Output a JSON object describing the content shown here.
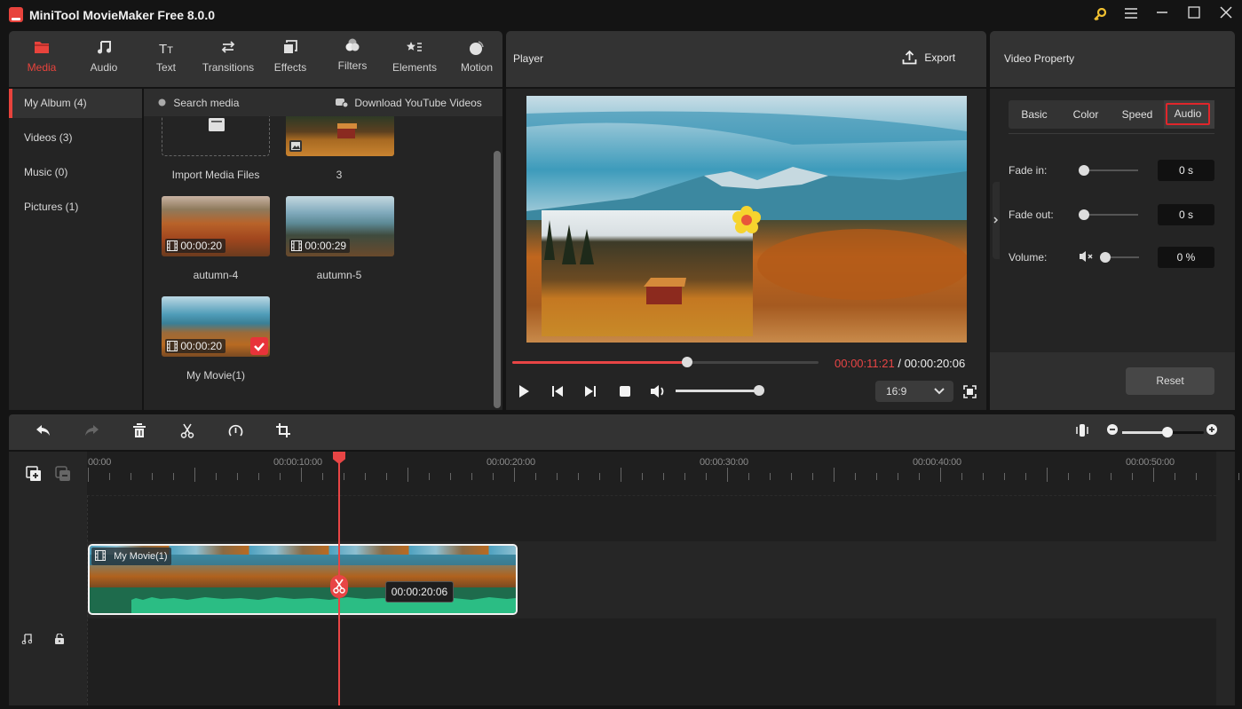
{
  "app": {
    "title": "MiniTool MovieMaker Free 8.0.0",
    "window_buttons": [
      "key-icon",
      "menu-icon",
      "minimize-icon",
      "maximize-icon",
      "close-icon"
    ]
  },
  "toolbar": {
    "items": [
      {
        "label": "Media",
        "icon": "folder-icon",
        "active": true
      },
      {
        "label": "Audio",
        "icon": "music-icon"
      },
      {
        "label": "Text",
        "icon": "text-icon"
      },
      {
        "label": "Transitions",
        "icon": "transitions-icon"
      },
      {
        "label": "Effects",
        "icon": "effects-icon"
      },
      {
        "label": "Filters",
        "icon": "filters-icon"
      },
      {
        "label": "Elements",
        "icon": "elements-icon"
      },
      {
        "label": "Motion",
        "icon": "motion-icon"
      }
    ]
  },
  "sidebar": {
    "categories": [
      {
        "label": "My Album (4)",
        "active": true
      },
      {
        "label": "Videos (3)"
      },
      {
        "label": "Music (0)"
      },
      {
        "label": "Pictures (1)"
      }
    ]
  },
  "media": {
    "search_placeholder": "Search media",
    "download_label": "Download YouTube Videos",
    "items": [
      {
        "name": "Import Media Files",
        "type": "import"
      },
      {
        "name": "3",
        "type": "image"
      },
      {
        "name": "autumn-4",
        "type": "video",
        "duration": "00:00:20"
      },
      {
        "name": "autumn-5",
        "type": "video",
        "duration": "00:00:29"
      },
      {
        "name": "My Movie(1)",
        "type": "video",
        "duration": "00:00:20",
        "added": true
      }
    ]
  },
  "player": {
    "title": "Player",
    "export_label": "Export",
    "current_time": "00:00:11:21",
    "total_time": "/ 00:00:20:06",
    "progress_fraction": 0.57,
    "volume_fraction": 1.0,
    "aspect_ratio": "16:9"
  },
  "property": {
    "title": "Video Property",
    "tabs": [
      {
        "label": "Basic"
      },
      {
        "label": "Color"
      },
      {
        "label": "Speed"
      },
      {
        "label": "Audio",
        "active": true
      }
    ],
    "fade_in": {
      "label": "Fade in:",
      "value": "0 s",
      "fraction": 0
    },
    "fade_out": {
      "label": "Fade out:",
      "value": "0 s",
      "fraction": 0
    },
    "volume": {
      "label": "Volume:",
      "value": "0 %",
      "fraction": 0
    },
    "reset_label": "Reset"
  },
  "timeline": {
    "toolbar_icons": [
      "undo-icon",
      "redo-icon",
      "delete-icon",
      "split-icon",
      "speed-icon",
      "crop-icon"
    ],
    "zoom_fraction": 0.55,
    "ruler_labels": [
      "00:00",
      "00:00:10:00",
      "00:00:20:00",
      "00:00:30:00",
      "00:00:40:00",
      "00:00:50:00"
    ],
    "clip": {
      "name": "My Movie(1)",
      "tooltip": "00:00:20:06"
    },
    "playhead_time": "00:00:11:21"
  }
}
